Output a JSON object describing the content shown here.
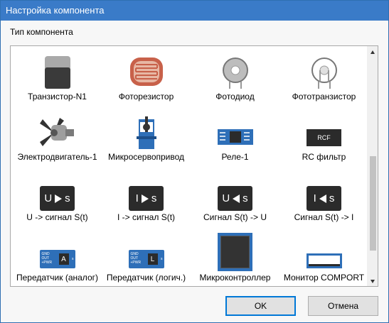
{
  "window": {
    "title": "Настройка компонента"
  },
  "group_label": "Тип компонента",
  "components": [
    {
      "label": "Транзистор-N1",
      "icon": "transistor-icon"
    },
    {
      "label": "Фоторезистор",
      "icon": "photoresistor-icon"
    },
    {
      "label": "Фотодиод",
      "icon": "photodiode-icon"
    },
    {
      "label": "Фототранзистор",
      "icon": "phototransistor-icon"
    },
    {
      "label": "Электродвигатель-1",
      "icon": "motor-icon"
    },
    {
      "label": "Микросервопривод",
      "icon": "servo-icon"
    },
    {
      "label": "Реле-1",
      "icon": "relay-icon"
    },
    {
      "label": "RC фильтр",
      "icon": "rc-filter-icon",
      "icon_text": "RCF"
    },
    {
      "label": "U -> сигнал S(t)",
      "icon": "u-to-signal-icon",
      "icon_text": "U",
      "icon_text2": "s"
    },
    {
      "label": "I -> сигнал S(t)",
      "icon": "i-to-signal-icon",
      "icon_text": "I",
      "icon_text2": "s"
    },
    {
      "label": "Сигнал S(t) -> U",
      "icon": "signal-to-u-icon",
      "icon_text": "U",
      "icon_text2": "s"
    },
    {
      "label": "Сигнал S(t) -> I",
      "icon": "signal-to-i-icon",
      "icon_text": "I",
      "icon_text2": "s"
    },
    {
      "label": "Передатчик (аналог)",
      "icon": "analog-transmitter-icon",
      "icon_text": "A",
      "pins": [
        "GND",
        "OUT",
        "+PWR"
      ],
      "s": "s"
    },
    {
      "label": "Передатчик (логич.)",
      "icon": "logic-transmitter-icon",
      "icon_text": "L",
      "pins": [
        "GND",
        "OUT",
        "+PWR"
      ],
      "s": "s"
    },
    {
      "label": "Микроконтроллер",
      "icon": "microcontroller-icon"
    },
    {
      "label": "Монитор COMPORT",
      "icon": "com-monitor-icon"
    }
  ],
  "buttons": {
    "ok": "OK",
    "cancel": "Отмена"
  },
  "colors": {
    "titlebar": "#3a7bc8",
    "board_blue": "#2e6fb8",
    "dark": "#2b2b2b"
  }
}
